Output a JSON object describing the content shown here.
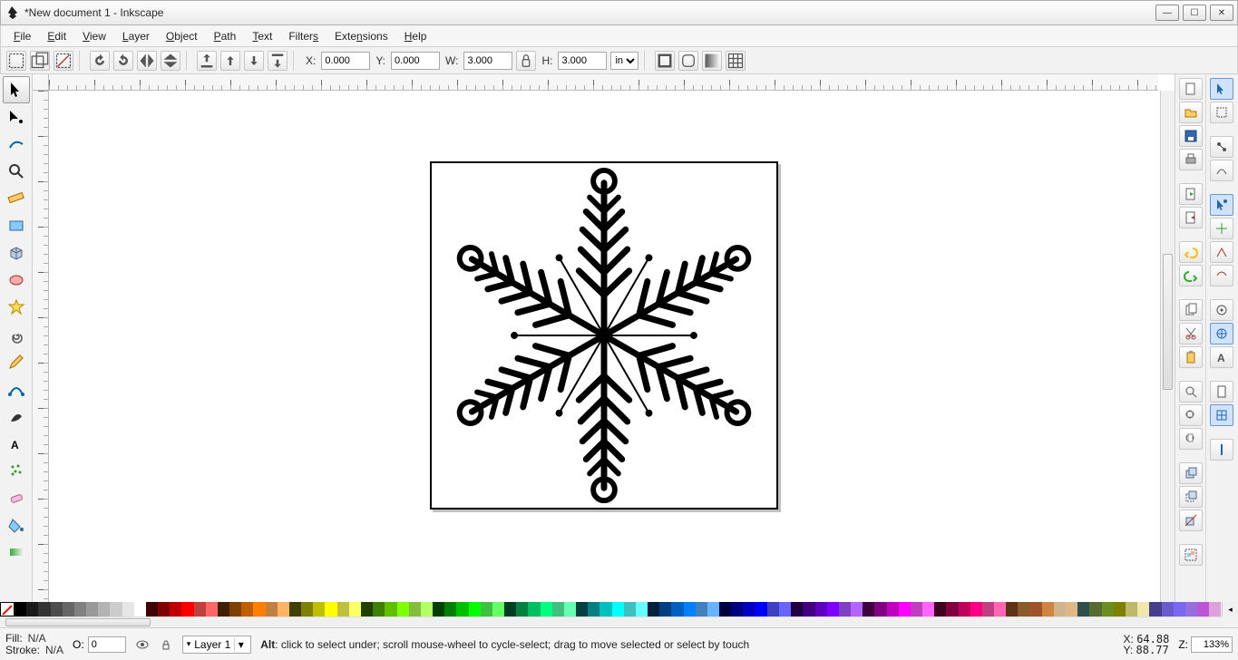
{
  "window": {
    "title": "*New document 1 - Inkscape"
  },
  "menu": [
    "File",
    "Edit",
    "View",
    "Layer",
    "Object",
    "Path",
    "Text",
    "Filters",
    "Extensions",
    "Help"
  ],
  "optbar": {
    "x_label": "X:",
    "x": "0.000",
    "y_label": "Y:",
    "y": "0.000",
    "w_label": "W:",
    "w": "3.000",
    "h_label": "H:",
    "h": "3.000",
    "unit": "in"
  },
  "status": {
    "fill_label": "Fill:",
    "fill_value": "N/A",
    "stroke_label": "Stroke:",
    "stroke_value": "N/A",
    "opacity_label": "O:",
    "opacity_value": "0",
    "layer": "Layer 1",
    "hint_strong": "Alt",
    "hint_rest": ": click to select under; scroll mouse-wheel to cycle-select; drag to move selected or select by touch",
    "x_label": "X:",
    "x_value": "64.88",
    "y_label": "Y:",
    "y_value": "88.77",
    "z_label": "Z:",
    "zoom": "133%"
  },
  "palette": [
    "#000000",
    "#1a1a1a",
    "#333333",
    "#4d4d4d",
    "#666666",
    "#808080",
    "#999999",
    "#b3b3b3",
    "#cccccc",
    "#e6e6e6",
    "#ffffff",
    "#400000",
    "#800000",
    "#bf0000",
    "#ff0000",
    "#bf4040",
    "#ff6666",
    "#402000",
    "#804000",
    "#bf6000",
    "#ff8000",
    "#bf8040",
    "#ffb366",
    "#404000",
    "#808000",
    "#bfbf00",
    "#ffff00",
    "#bfbf40",
    "#ffff66",
    "#204000",
    "#408000",
    "#60bf00",
    "#80ff00",
    "#80bf40",
    "#b3ff66",
    "#004000",
    "#008000",
    "#00bf00",
    "#00ff00",
    "#40bf40",
    "#66ff66",
    "#004020",
    "#008040",
    "#00bf60",
    "#00ff80",
    "#40bf80",
    "#66ffb3",
    "#004040",
    "#008080",
    "#00bfbf",
    "#00ffff",
    "#40bfbf",
    "#66ffff",
    "#002040",
    "#004080",
    "#0060bf",
    "#0080ff",
    "#4080bf",
    "#66b3ff",
    "#000040",
    "#000080",
    "#0000bf",
    "#0000ff",
    "#4040bf",
    "#6666ff",
    "#200040",
    "#400080",
    "#6000bf",
    "#8000ff",
    "#8040bf",
    "#b366ff",
    "#400040",
    "#800080",
    "#bf00bf",
    "#ff00ff",
    "#bf40bf",
    "#ff66ff",
    "#400020",
    "#800040",
    "#bf0060",
    "#ff0080",
    "#bf4080",
    "#ff66b3",
    "#5c3317",
    "#8b5a2b",
    "#a0522d",
    "#cd853f",
    "#d2b48c",
    "#deb887",
    "#2f4f4f",
    "#556b2f",
    "#6b8e23",
    "#808000",
    "#bdb76b",
    "#eee8aa",
    "#483d8b",
    "#6a5acd",
    "#7b68ee",
    "#9370db",
    "#ba55d3",
    "#dda0dd"
  ]
}
